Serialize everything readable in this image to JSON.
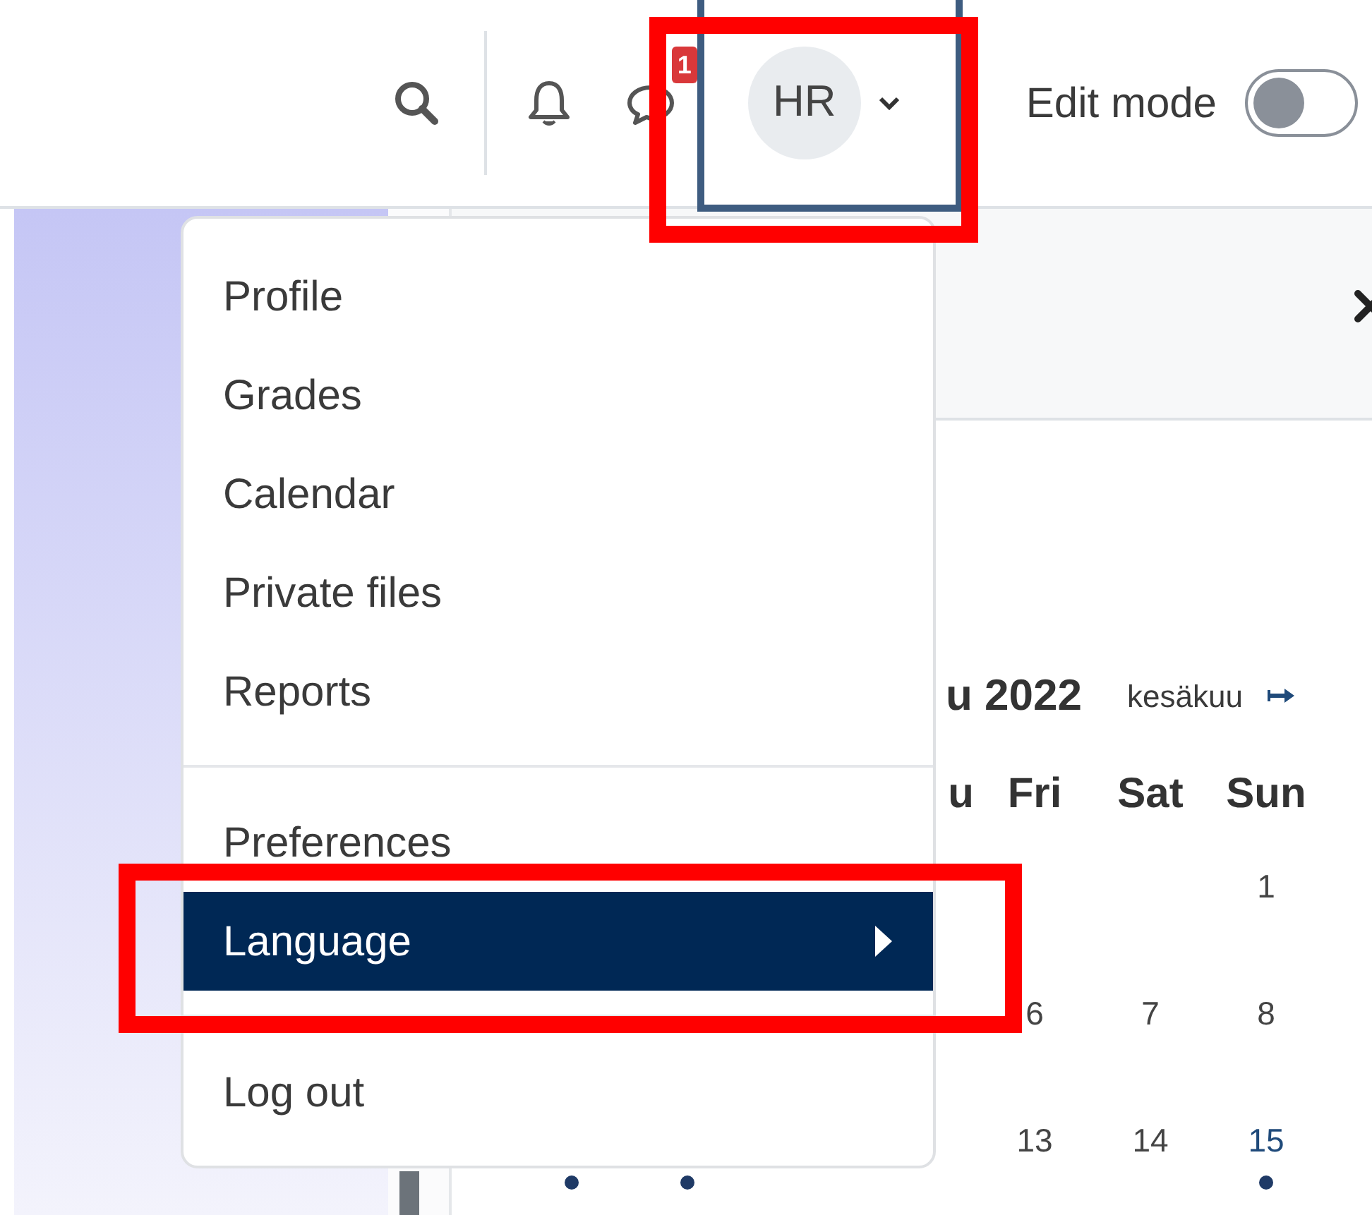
{
  "toolbar": {
    "message_badge": "1",
    "user_toggle": {
      "initials": "HR",
      "focused": true,
      "annotated": true
    },
    "edit_mode": {
      "label": "Edit mode",
      "on": false
    }
  },
  "user_menu": {
    "groups": [
      [
        {
          "label": "Profile",
          "selected": false,
          "has_submenu": false,
          "annotated": false
        },
        {
          "label": "Grades",
          "selected": false,
          "has_submenu": false,
          "annotated": false
        },
        {
          "label": "Calendar",
          "selected": false,
          "has_submenu": false,
          "annotated": false
        },
        {
          "label": "Private files",
          "selected": false,
          "has_submenu": false,
          "annotated": false
        },
        {
          "label": "Reports",
          "selected": false,
          "has_submenu": false,
          "annotated": false
        }
      ],
      [
        {
          "label": "Preferences",
          "selected": false,
          "has_submenu": false,
          "annotated": false
        },
        {
          "label": "Language",
          "selected": true,
          "has_submenu": true,
          "annotated": true
        }
      ],
      [
        {
          "label": "Log out",
          "selected": false,
          "has_submenu": false,
          "annotated": false
        }
      ]
    ]
  },
  "calendar": {
    "title": "u 2022",
    "next_link": "kesäkuu",
    "weekdays": [
      "u",
      "Fri",
      "Sat",
      "Sun"
    ],
    "weeks": [
      {
        "days": [
          {
            "day": "1",
            "has_events": false
          }
        ]
      },
      {
        "days": [
          {
            "day": "6",
            "has_events": false
          },
          {
            "day": "7",
            "has_events": false
          },
          {
            "day": "8",
            "has_events": false
          }
        ]
      },
      {
        "covered_days": [
          {
            "has_events": true
          },
          {
            "has_events": true
          }
        ],
        "days": [
          {
            "day": "13",
            "has_events": false
          },
          {
            "day": "14",
            "has_events": false
          },
          {
            "day": "15",
            "has_events": true
          }
        ]
      }
    ]
  }
}
